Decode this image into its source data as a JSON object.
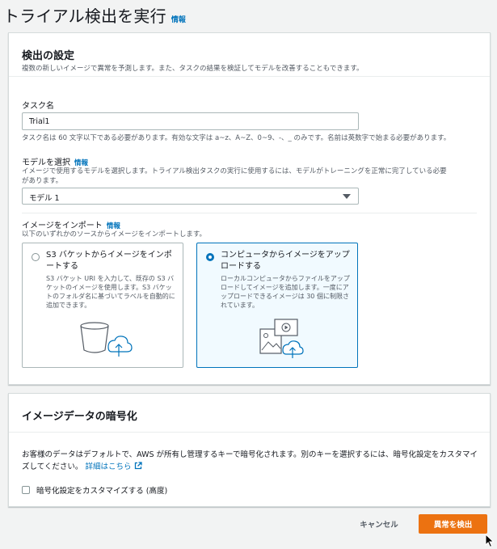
{
  "page": {
    "title": "トライアル検出を実行",
    "info_label": "情報"
  },
  "detection": {
    "title": "検出の設定",
    "description": "複数の新しいイメージで異常を予測します。また、タスクの結果を検証してモデルを改善することもできます。",
    "task_name": {
      "label": "タスク名",
      "value": "Trial1",
      "hint": "タスク名は 60 文字以下である必要があります。有効な文字は a~z、A~Z、0~9、-、_ のみです。名前は英数字で始まる必要があります。"
    },
    "model": {
      "label": "モデルを選択",
      "info_label": "情報",
      "hint_line1": "イメージで使用するモデルを選択します。トライアル検出タスクの実行に使用するには、モデルがトレーニングを正常に完了している必要",
      "hint_line2": "があります。",
      "selected": "モデル 1"
    },
    "import": {
      "label": "イメージをインポート",
      "info_label": "情報",
      "hint": "以下のいずれかのソースからイメージをインポートします。",
      "options": [
        {
          "title": "S3 バケットからイメージをインポートする",
          "description": "S3 バケット URI を入力して、既存の S3 バケットのイメージを使用します。S3 バケットのフォルダ名に基づいてラベルを自動的に追加できます。",
          "icon": "s3-bucket-upload-icon",
          "selected": false
        },
        {
          "title": "コンピュータからイメージをアップロードする",
          "description": "ローカルコンピュータからファイルをアップロードしてイメージを追加します。一度にアップロードできるイメージは 30 個に制限されています。",
          "icon": "computer-media-upload-icon",
          "selected": true
        }
      ]
    }
  },
  "encryption": {
    "title": "イメージデータの暗号化",
    "body": "お客様のデータはデフォルトで、AWS が所有し管理するキーで暗号化されます。別のキーを選択するには、暗号化設定をカスタマイズしてください。",
    "link_label": "詳細はこちら",
    "checkbox_label": "暗号化設定をカスタマイズする (高度)",
    "checkbox_checked": false
  },
  "actions": {
    "cancel_label": "キャンセル",
    "submit_label": "異常を検出"
  },
  "colors": {
    "primary_button": "#ec7211",
    "link": "#0073bb",
    "selected_tile_border": "#0073bb",
    "selected_tile_bg": "#f1faff"
  }
}
